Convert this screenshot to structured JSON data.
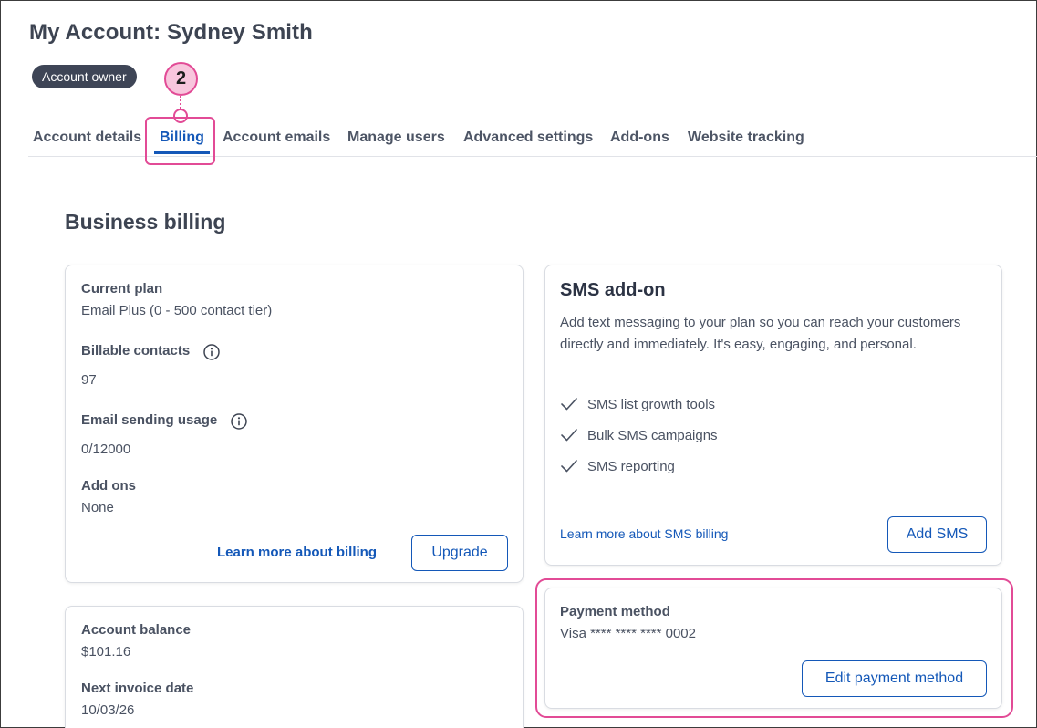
{
  "header": {
    "title": "My Account: Sydney Smith",
    "role_badge": "Account owner"
  },
  "annotation": {
    "step_number": "2",
    "highlight_color": "#e24b96"
  },
  "tabs": [
    {
      "label": "Account details",
      "active": false
    },
    {
      "label": "Billing",
      "active": true
    },
    {
      "label": "Account emails",
      "active": false
    },
    {
      "label": "Manage users",
      "active": false
    },
    {
      "label": "Advanced settings",
      "active": false
    },
    {
      "label": "Add-ons",
      "active": false
    },
    {
      "label": "Website tracking",
      "active": false
    }
  ],
  "section_title": "Business billing",
  "plan_card": {
    "current_plan_label": "Current plan",
    "current_plan_value": "Email Plus (0 - 500 contact tier)",
    "billable_contacts_label": "Billable contacts",
    "billable_contacts_value": "97",
    "email_usage_label": "Email sending usage",
    "email_usage_value": "0/12000",
    "addons_label": "Add ons",
    "addons_value": "None",
    "learn_more_link": "Learn more about billing",
    "upgrade_button": "Upgrade",
    "info_icon": "info-icon"
  },
  "balance_card": {
    "balance_label": "Account balance",
    "balance_value": "$101.16",
    "next_invoice_label": "Next invoice date",
    "next_invoice_value": "10/03/26"
  },
  "sms_card": {
    "title": "SMS add-on",
    "description": "Add text messaging to your plan so you can reach your customers directly and immediately. It's easy, engaging, and personal.",
    "features": [
      "SMS list growth tools",
      "Bulk SMS campaigns",
      "SMS reporting"
    ],
    "feature_icon": "check-icon",
    "learn_more_link": "Learn more about SMS billing",
    "add_button": "Add SMS"
  },
  "payment_card": {
    "label": "Payment method",
    "value": "Visa **** **** **** 0002",
    "edit_button": "Edit payment method"
  },
  "colors": {
    "primary": "#1458b8",
    "text": "#4a5262",
    "badge_bg": "#3e4556",
    "highlight": "#e24b96",
    "step_fill": "#f8c6dd"
  }
}
